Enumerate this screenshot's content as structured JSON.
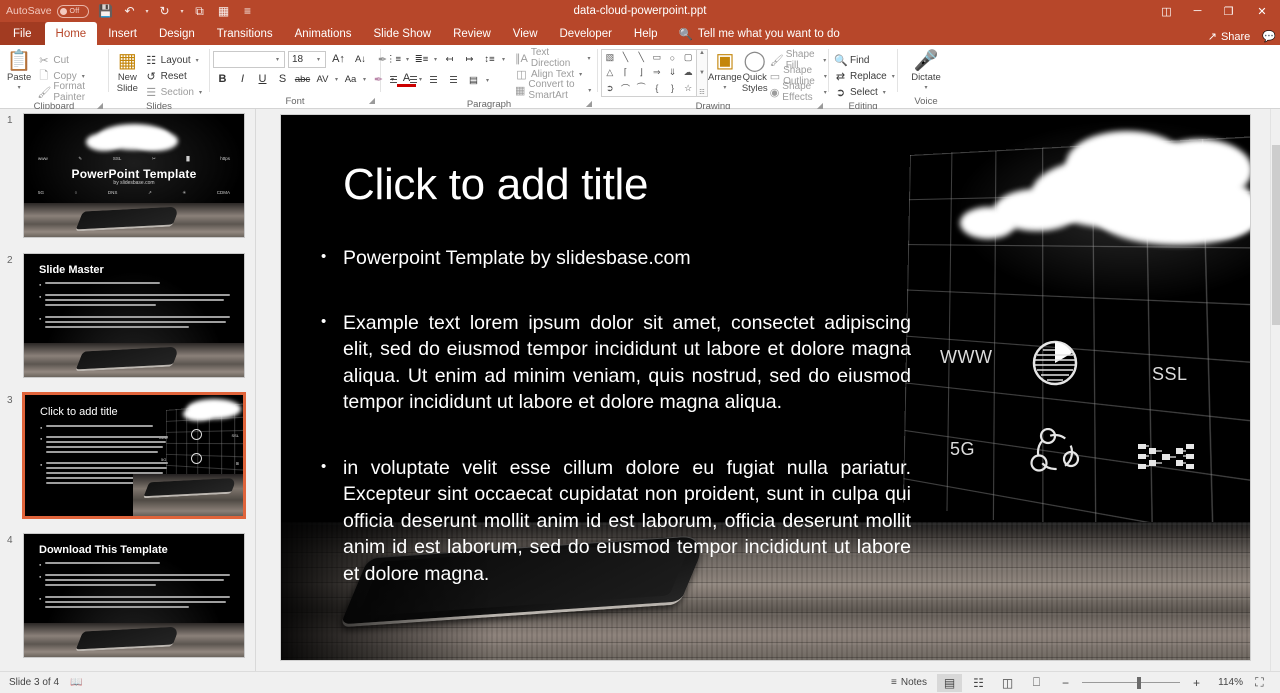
{
  "titlebar": {
    "autosave_label": "AutoSave",
    "autosave_state": "Off",
    "document_title": "data-cloud-powerpoint.ppt",
    "qat": [
      {
        "name": "save-icon",
        "glyph": "💾"
      },
      {
        "name": "undo-icon",
        "glyph": "↶"
      },
      {
        "name": "redo-icon",
        "glyph": "↻"
      },
      {
        "name": "start-presentation-icon",
        "glyph": "⧉"
      },
      {
        "name": "reading-view-icon",
        "glyph": "▦"
      },
      {
        "name": "customize-qat-icon",
        "glyph": "≡"
      }
    ],
    "window_controls": [
      {
        "name": "ribbon-display-options-button",
        "glyph": "□"
      },
      {
        "name": "minimize-button",
        "glyph": "─"
      },
      {
        "name": "restore-button",
        "glyph": "❐"
      },
      {
        "name": "close-button",
        "glyph": "✕"
      }
    ],
    "share_label": "Share",
    "comments_label": ""
  },
  "tabs": [
    {
      "label": "File",
      "active": false,
      "file": true
    },
    {
      "label": "Home",
      "active": true,
      "file": false
    },
    {
      "label": "Insert",
      "active": false,
      "file": false
    },
    {
      "label": "Design",
      "active": false,
      "file": false
    },
    {
      "label": "Transitions",
      "active": false,
      "file": false
    },
    {
      "label": "Animations",
      "active": false,
      "file": false
    },
    {
      "label": "Slide Show",
      "active": false,
      "file": false
    },
    {
      "label": "Review",
      "active": false,
      "file": false
    },
    {
      "label": "View",
      "active": false,
      "file": false
    },
    {
      "label": "Developer",
      "active": false,
      "file": false
    },
    {
      "label": "Help",
      "active": false,
      "file": false
    }
  ],
  "tell_me": {
    "placeholder": "Tell me what you want to do",
    "icon": "search-icon"
  },
  "ribbon": {
    "clipboard": {
      "label": "Clipboard",
      "paste": "Paste",
      "cut": "Cut",
      "copy": "Copy",
      "format_painter": "Format Painter"
    },
    "slides": {
      "label": "Slides",
      "new_slide": "New\nSlide",
      "new_slide_line1": "New",
      "new_slide_line2": "Slide",
      "layout": "Layout",
      "reset": "Reset",
      "section": "Section"
    },
    "font": {
      "label": "Font",
      "font_name": "",
      "font_size": "18",
      "grow": "A",
      "shrink": "A",
      "clear_formatting": "✐",
      "bold": "B",
      "italic": "I",
      "underline": "U",
      "shadow": "S",
      "strikethrough": "abc",
      "character_spacing": "AV",
      "change_case": "Aa",
      "text_highlight": "✎",
      "font_color": "A"
    },
    "paragraph": {
      "label": "Paragraph",
      "text_direction": "Text Direction",
      "align_text": "Align Text",
      "convert_to_smartart": "Convert to SmartArt"
    },
    "drawing": {
      "label": "Drawing",
      "arrange": "Arrange",
      "quick_styles_line1": "Quick",
      "quick_styles_line2": "Styles",
      "shape_fill": "Shape Fill",
      "shape_outline": "Shape Outline",
      "shape_effects": "Shape Effects",
      "shapes": [
        "▧",
        "╲",
        "╲",
        "▭",
        "◯",
        "▢",
        "△",
        "⌐",
        "⌙",
        "⇨",
        "⇩",
        "☁",
        "➲",
        "⌒",
        "◜",
        "{",
        "}",
        "☆"
      ]
    },
    "editing": {
      "label": "Editing",
      "find": "Find",
      "replace": "Replace",
      "select": "Select"
    },
    "voice": {
      "label": "Voice",
      "dictate": "Dictate"
    }
  },
  "slides_panel": [
    {
      "number": "1",
      "kind": "title",
      "title": "PowerPoint Template",
      "subtitle": "by slidesbase.com",
      "icons_top": [
        "www",
        "✎",
        "SSL",
        "✂",
        "█",
        "https"
      ],
      "icons_bottom": [
        "5G",
        "○",
        "DNS",
        "↗",
        "✳",
        "CDMA"
      ],
      "selected": false
    },
    {
      "number": "2",
      "kind": "content",
      "title": "Slide Master",
      "bullets": [
        "Powerpoint Template by slidesbase.com",
        "Example text lorem ipsum dolor sit amet, consectet adipiscing elit, sed do eiusmod tempor incididunt ut labore et dolore magna aliqua. Ut enim ad minim veniam, quis nostrud, sed do eiusmod tempor incididunt ut labore et dolore magna aliqua.",
        "In voluptate velit esse cillum dolore eu fugiat nulla pariatur. Excepteur sint occaecat cupidatat non proident, sunt in culpa qui officia deserunt mollit anim id est laborum, officia deserunt mollit anim id est laborum, sed do eiusmod tempor incididunt ut labore et dolore magna."
      ],
      "selected": false
    },
    {
      "number": "3",
      "kind": "content-cloud",
      "title": "Click to add title",
      "bullets": [
        "Powerpoint Template by slidesbase.com",
        "Example text lorem ipsum dolor sit amet, consectet adipiscing elit, sed do eiusmod tempor incididunt ut labore et dolore magna aliqua. Ut enim ad minim veniam, quis nostrud, sed do eiusmod tempor incididunt ut labore et dolore magna aliqua.",
        "In voluptate velit esse cillum dolore eu fugiat nulla pariatur. Excepteur sint occaecat cupidatat non proident, sunt in culpa qui officia deserunt mollit anim id est laborum, officia deserunt mollit anim id est laborum, sed do eiusmod tempor incididunt ut labore et dolore magna."
      ],
      "selected": true
    },
    {
      "number": "4",
      "kind": "content",
      "title": "Download This Template",
      "bullets": [
        "Powerpoint Template by slidesbase.com",
        "Example text lorem ipsum dolor sit amet, consectet adipiscing elit, sed do eiusmod tempor incididunt ut labore et dolore magna aliqua. Ut enim ad minim veniam, quis nostrud, sed do eiusmod tempor incididunt ut labore et dolore magna aliqua.",
        "In voluptate velit esse cillum dolore eu fugiat nulla pariatur. Excepteur sint occaecat cupidatat non proident, sunt in culpa qui officia deserunt mollit anim id est laborum, officia deserunt mollit anim id est laborum, sed do eiusmod tempor incididunt ut labore et dolore magna."
      ],
      "selected": false
    }
  ],
  "slide": {
    "title": "Click to add title",
    "bullet_1": "Powerpoint Template by slidesbase.com",
    "bullet_2": "Example text lorem ipsum dolor sit amet, consectet adipiscing elit, sed do eiusmod tempor incididunt ut labore et dolore magna aliqua. Ut enim ad minim veniam, quis nostrud, sed do eiusmod tempor incididunt ut labore et dolore magna aliqua.",
    "bullet_3": "in voluptate velit esse cillum dolore eu fugiat nulla pariatur. Excepteur sint occaecat cupidatat non proident, sunt in culpa qui officia deserunt mollit anim id est laborum, officia deserunt mollit anim id est laborum, sed do eiusmod tempor incididunt ut labore et dolore magna.",
    "art_labels": {
      "www": "WWW",
      "ssl": "SSL",
      "fiveg": "5G"
    }
  },
  "statusbar": {
    "slide_indicator": "Slide 3 of 4",
    "accessibility_icon": "notes-page-icon",
    "notes_label": "Notes",
    "views": [
      {
        "name": "normal-view-button",
        "glyph": "▤",
        "active": true
      },
      {
        "name": "slide-sorter-button",
        "glyph": "☷",
        "active": false
      },
      {
        "name": "reading-view-button",
        "glyph": "▥",
        "active": false
      },
      {
        "name": "slide-show-button",
        "glyph": "▷",
        "active": false
      }
    ],
    "zoom_out": "−",
    "zoom_in": "+",
    "zoom_level": "114%",
    "fit_to_window_icon": "fit-slide-icon"
  },
  "colors": {
    "accent": "#b7472a",
    "file_tab": "#a23b21",
    "selection": "#e0643b",
    "ribbon_bg": "#ffffff",
    "panel_bg": "#f0f0f0",
    "slide_bg": "#000000"
  }
}
